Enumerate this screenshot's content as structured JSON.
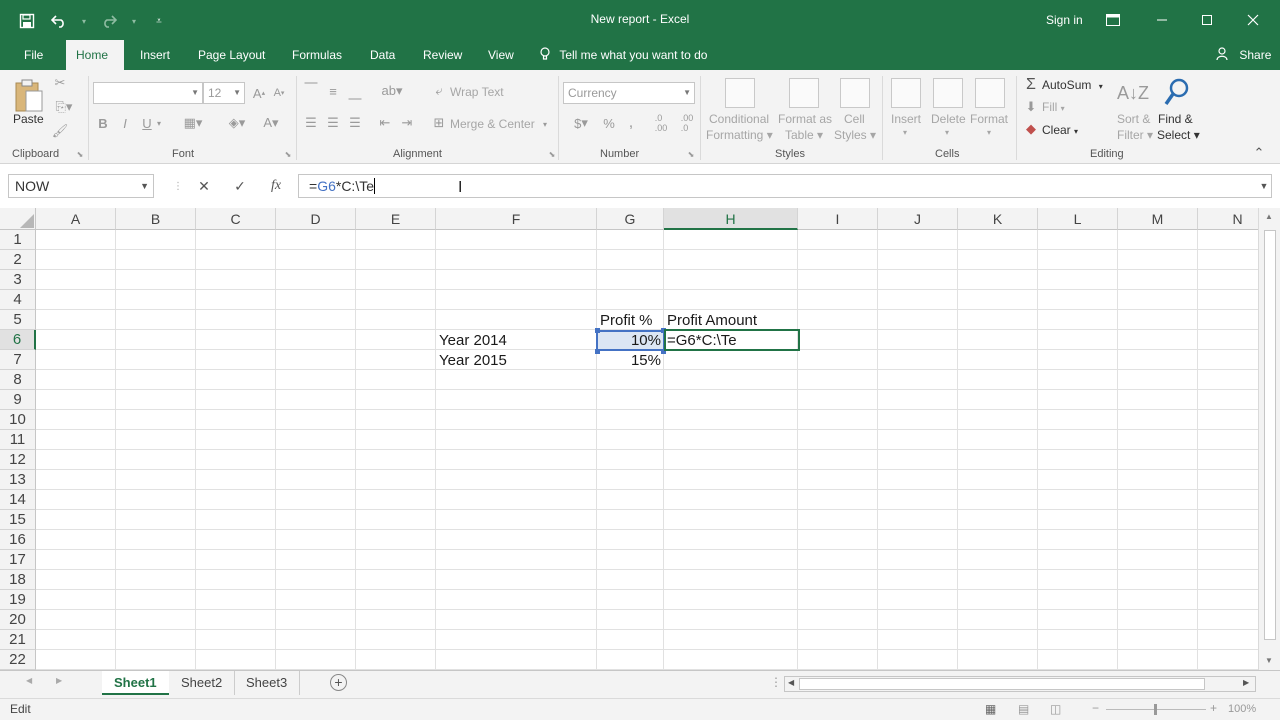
{
  "window": {
    "title": "New report - Excel",
    "sign_in": "Sign in",
    "share": "Share"
  },
  "quick_access": {
    "save_icon": "save-icon",
    "undo_icon": "undo-icon",
    "redo_icon": "redo-icon",
    "customize_icon": "customize-qat-icon"
  },
  "tabs": [
    "File",
    "Home",
    "Insert",
    "Page Layout",
    "Formulas",
    "Data",
    "Review",
    "View"
  ],
  "active_tab": "Home",
  "tell_me": "Tell me what you want to do",
  "ribbon": {
    "clipboard": {
      "label": "Clipboard",
      "paste": "Paste"
    },
    "font": {
      "label": "Font",
      "font_name": "",
      "font_size": "12",
      "bold": "B",
      "italic": "I",
      "underline": "U"
    },
    "alignment": {
      "label": "Alignment",
      "wrap_text": "Wrap Text",
      "merge_center": "Merge & Center"
    },
    "number": {
      "label": "Number",
      "format": "Currency",
      "currency_symbol": "$",
      "percent_symbol": "%",
      "comma_symbol": ","
    },
    "styles": {
      "label": "Styles",
      "conditional": "Conditional",
      "formatting": "Formatting",
      "format_as": "Format as",
      "table": "Table",
      "cell": "Cell",
      "cell_styles": "Styles"
    },
    "cells": {
      "label": "Cells",
      "insert": "Insert",
      "delete": "Delete",
      "format": "Format"
    },
    "editing": {
      "label": "Editing",
      "autosum": "AutoSum",
      "fill": "Fill",
      "clear": "Clear",
      "sort": "Sort &",
      "filter": "Filter",
      "find": "Find &",
      "select": "Select"
    }
  },
  "formula_bar": {
    "name_box": "NOW",
    "formula_prefix": "=",
    "formula_ref": "G6",
    "formula_rest": "*C:\\Te",
    "cancel": "✕",
    "enter": "✓",
    "fx": "fx"
  },
  "grid": {
    "columns": [
      "A",
      "B",
      "C",
      "D",
      "E",
      "F",
      "G",
      "H",
      "I",
      "J",
      "K",
      "L",
      "M",
      "N"
    ],
    "rows": [
      "1",
      "2",
      "3",
      "4",
      "5",
      "6",
      "7",
      "8",
      "9",
      "10",
      "11",
      "12",
      "13",
      "14",
      "15",
      "16",
      "17",
      "18",
      "19",
      "20",
      "21",
      "22"
    ],
    "cells": {
      "G5": "Profit %",
      "H5": "Profit Amount",
      "F6": "Year 2014",
      "G6": "10%",
      "H6": "=G6*C:\\Te",
      "F7": "Year 2015",
      "G7": "15%"
    },
    "selected_column": "H",
    "selected_row": "6"
  },
  "sheets": [
    "Sheet1",
    "Sheet2",
    "Sheet3"
  ],
  "active_sheet": "Sheet1",
  "status": {
    "mode": "Edit",
    "zoom": "100%"
  },
  "colors": {
    "excel_green": "#217346",
    "ref_blue": "#4472c4"
  }
}
